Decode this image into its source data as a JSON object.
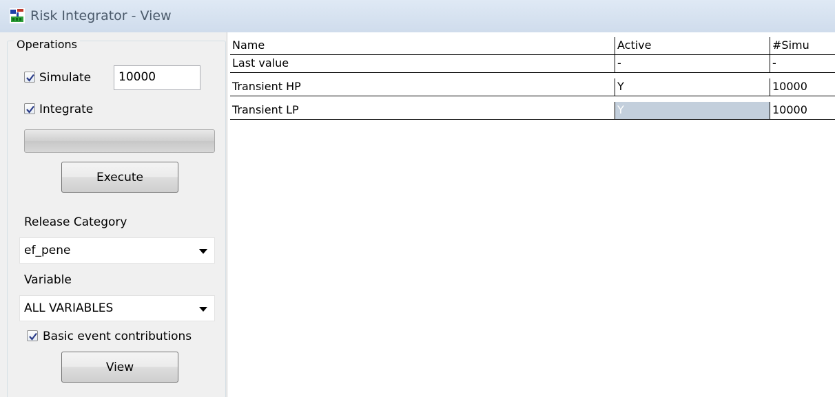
{
  "window": {
    "title": "Risk Integrator  - View",
    "icon": "risk-integrator-app-icon"
  },
  "operations": {
    "group_label": "Operations",
    "simulate": {
      "label": "Simulate",
      "checked": true,
      "value": "10000"
    },
    "integrate": {
      "label": "Integrate",
      "checked": true
    },
    "progress_percent": 0,
    "execute_label": "Execute"
  },
  "release": {
    "label": "Release Category",
    "selected": "ef_pene"
  },
  "variable": {
    "label": "Variable",
    "selected": "ALL VARIABLES"
  },
  "basic_event": {
    "label": "Basic event contributions",
    "checked": true
  },
  "view_label": "View",
  "table": {
    "headers": [
      "Name",
      "Active",
      "#Simu"
    ],
    "rows": [
      [
        "Last value",
        "-",
        "-"
      ],
      [
        "Transient HP",
        "Y",
        "10000"
      ],
      [
        "Transient LP",
        "Y",
        "10000"
      ]
    ]
  },
  "colors": {
    "selection": "#c3cfdc",
    "titlebar": "#dfe9f5"
  }
}
